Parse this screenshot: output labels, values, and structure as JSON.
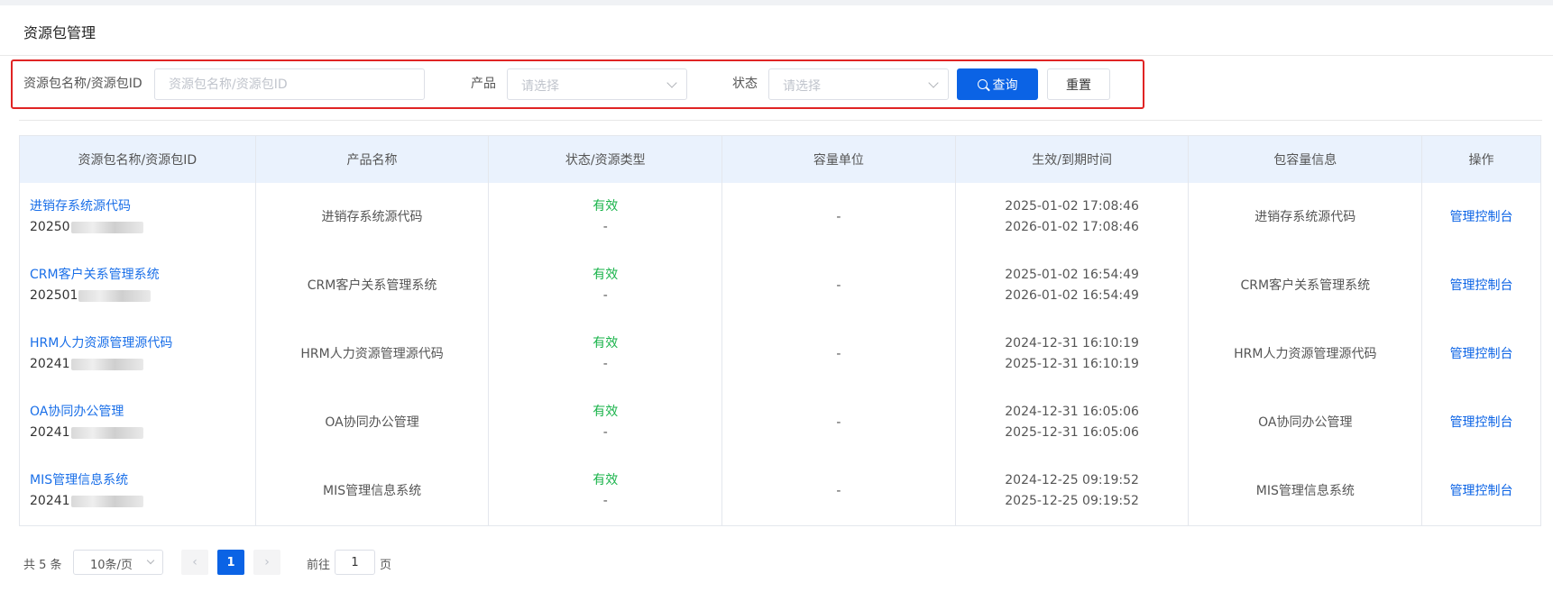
{
  "header": {
    "title": "资源包管理"
  },
  "filters": {
    "name_label": "资源包名称/资源包ID",
    "name_placeholder": "资源包名称/资源包ID",
    "product_label": "产品",
    "product_placeholder": "请选择",
    "status_label": "状态",
    "status_placeholder": "请选择",
    "query_label": "查询",
    "reset_label": "重置"
  },
  "table": {
    "columns": [
      "资源包名称/资源包ID",
      "产品名称",
      "状态/资源类型",
      "容量单位",
      "生效/到期时间",
      "包容量信息",
      "操作"
    ],
    "rows": [
      {
        "name": "进销存系统源代码",
        "id_prefix": "20250",
        "product": "进销存系统源代码",
        "status": "有效",
        "type": "-",
        "unit": "-",
        "start": "2025-01-02 17:08:46",
        "end": "2026-01-02 17:08:46",
        "capacity": "进销存系统源代码",
        "action": "管理控制台"
      },
      {
        "name": "CRM客户关系管理系统",
        "id_prefix": "202501",
        "product": "CRM客户关系管理系统",
        "status": "有效",
        "type": "-",
        "unit": "-",
        "start": "2025-01-02 16:54:49",
        "end": "2026-01-02 16:54:49",
        "capacity": "CRM客户关系管理系统",
        "action": "管理控制台"
      },
      {
        "name": "HRM人力资源管理源代码",
        "id_prefix": "20241",
        "product": "HRM人力资源管理源代码",
        "status": "有效",
        "type": "-",
        "unit": "-",
        "start": "2024-12-31 16:10:19",
        "end": "2025-12-31 16:10:19",
        "capacity": "HRM人力资源管理源代码",
        "action": "管理控制台"
      },
      {
        "name": "OA协同办公管理",
        "id_prefix": "20241",
        "product": "OA协同办公管理",
        "status": "有效",
        "type": "-",
        "unit": "-",
        "start": "2024-12-31 16:05:06",
        "end": "2025-12-31 16:05:06",
        "capacity": "OA协同办公管理",
        "action": "管理控制台"
      },
      {
        "name": "MIS管理信息系统",
        "id_prefix": "20241",
        "product": "MIS管理信息系统",
        "status": "有效",
        "type": "-",
        "unit": "-",
        "start": "2024-12-25 09:19:52",
        "end": "2025-12-25 09:19:52",
        "capacity": "MIS管理信息系统",
        "action": "管理控制台"
      }
    ]
  },
  "pagination": {
    "total_text": "共 5 条",
    "page_size": "10条/页",
    "prev_icon": "chevron-left-icon",
    "next_icon": "chevron-right-icon",
    "current_page": "1",
    "goto_prefix": "前往",
    "goto_value": "1",
    "goto_suffix": "页"
  },
  "colors": {
    "primary": "#0b63e5",
    "link": "#1a6fe8",
    "status_ok": "#19b34a",
    "highlight_border": "#e02424",
    "header_bg": "#eaf2fd"
  }
}
